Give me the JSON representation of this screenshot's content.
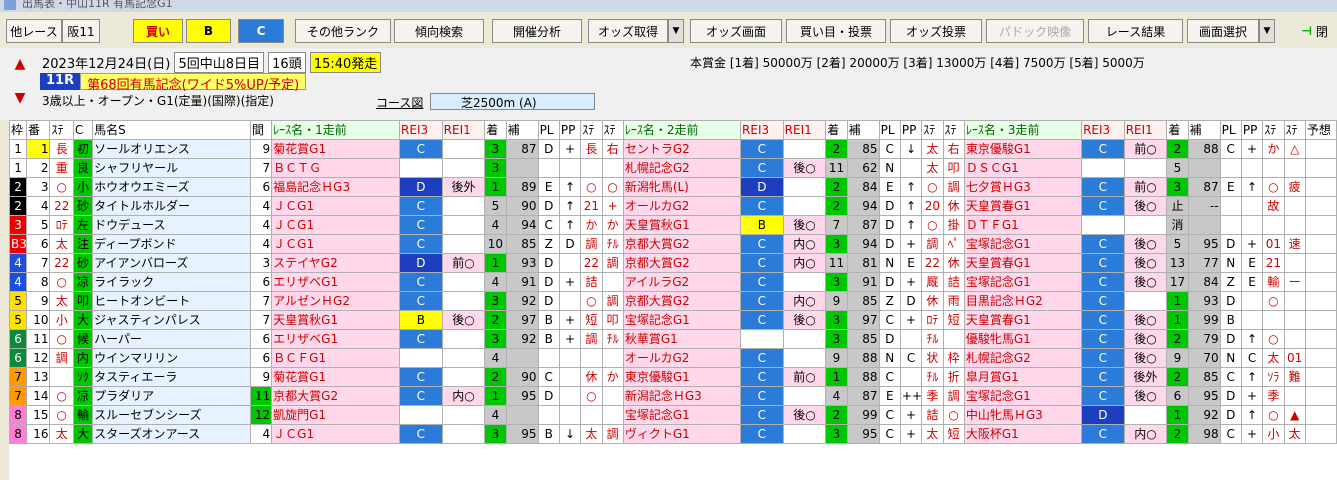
{
  "title": "出馬表・中山11R 有馬記念G1",
  "toolbar": {
    "other": "他レース",
    "race": "阪11",
    "buy": "買い",
    "b": "B",
    "c": "C",
    "other_rank": "その他ランク",
    "trend": "傾向検索",
    "analysis": "開催分析",
    "odds_get": "オッズ取得",
    "odds_view": "オッズ画面",
    "bet": "買い目・投票",
    "odds_vote": "オッズ投票",
    "video": "パドック映像",
    "result": "レース結果",
    "select": "画面選択",
    "close": "閉"
  },
  "info": {
    "date": "2023年12月24日(日)",
    "kai": "5回中山8日目",
    "heads": "16頭",
    "start": "15:40発走",
    "prize": "本賞金 [1着] 50000万 [2着] 20000万 [3着] 13000万 [4着] 7500万 [5着] 5000万",
    "race_no": "11R",
    "race_name": "第68回有馬記念(ワイド5%UP/予定)",
    "cond": "3歳以上・オープン・G1(定量)(国際)(指定)",
    "course_label": "コース図",
    "course": "芝2500m (A)"
  },
  "headers": [
    "枠",
    "番",
    "ｽﾃ",
    "C",
    "馬名S",
    "間",
    "ﾚｰｽ名・1走前",
    "REI3",
    "REI1",
    "着",
    "補",
    "PL",
    "PP",
    "ｽﾃ",
    "ｽﾃ",
    "ﾚｰｽ名・2走前",
    "REI3",
    "REI1",
    "着",
    "補",
    "PL",
    "PP",
    "ｽﾃ",
    "ｽﾃ",
    "ﾚｰｽ名・3走前",
    "REI3",
    "REI1",
    "着",
    "補",
    "PL",
    "PP",
    "ｽﾃ",
    "ｽﾃ",
    "予想"
  ],
  "rows": [
    {
      "w": "1",
      "n": "1",
      "m": "長",
      "c": "初",
      "name": "ソールオリエンス",
      "i": "9",
      "r1": [
        "菊花賞G1",
        "C",
        "",
        "3",
        "87",
        "D",
        "+",
        "長",
        "右"
      ],
      "r2": [
        "セントラG2",
        "C",
        "",
        "2",
        "85",
        "C",
        "↓",
        "太",
        "右"
      ],
      "r3": [
        "東京優駿G1",
        "C",
        "前○",
        "2",
        "88",
        "C",
        "+",
        "か",
        "△"
      ]
    },
    {
      "w": "1",
      "n": "2",
      "m": "重",
      "c": "良",
      "name": "シャフリヤール",
      "i": "7",
      "r1": [
        "ＢＣＴＧ",
        "",
        "",
        "3",
        "",
        "",
        "",
        "",
        ""
      ],
      "r2": [
        "札幌記念G2",
        "C",
        "後○",
        "11",
        "62",
        "N",
        "",
        "太",
        "叩"
      ],
      "r3": [
        "ＤＳＣG1",
        "",
        "",
        "5",
        "",
        "",
        "",
        "",
        ""
      ]
    },
    {
      "w": "2",
      "n": "3",
      "m": "○",
      "c": "小",
      "name": "ホウオウエミーズ",
      "i": "6",
      "r1": [
        "福島記念ＨG3",
        "D",
        "後外",
        "1",
        "89",
        "E",
        "↑",
        "○",
        "○"
      ],
      "r2": [
        "新潟牝馬(L)",
        "D",
        "",
        "2",
        "84",
        "E",
        "↑",
        "○",
        "調"
      ],
      "r3": [
        "七夕賞ＨG3",
        "C",
        "前○",
        "3",
        "87",
        "E",
        "↑",
        "○",
        "疲"
      ]
    },
    {
      "w": "2",
      "n": "4",
      "m": "22",
      "c": "砂",
      "name": "タイトルホルダー",
      "i": "4",
      "r1": [
        "ＪＣG1",
        "C",
        "",
        "5",
        "90",
        "D",
        "↑",
        "21",
        "+"
      ],
      "r2": [
        "オールカG2",
        "C",
        "",
        "2",
        "94",
        "D",
        "↑",
        "20",
        "休"
      ],
      "r3": [
        "天皇賞春G1",
        "C",
        "後○",
        "止",
        "--",
        "",
        "",
        "故",
        ""
      ]
    },
    {
      "w": "3",
      "n": "5",
      "m": "ﾛﾃ",
      "c": "左",
      "name": "ドウデュース",
      "i": "4",
      "r1": [
        "ＪＣG1",
        "C",
        "",
        "4",
        "94",
        "C",
        "↑",
        "か",
        "か"
      ],
      "r2": [
        "天皇賞秋G1",
        "B",
        "後○",
        "7",
        "87",
        "D",
        "↑",
        "○",
        "掛"
      ],
      "r3": [
        "ＤＴＦG1",
        "",
        "",
        "消",
        "",
        "",
        "",
        "",
        ""
      ]
    },
    {
      "w": "B3",
      "n": "6",
      "m": "太",
      "c": "注",
      "name": "ディープボンド",
      "i": "4",
      "r1": [
        "ＪＣG1",
        "C",
        "",
        "10",
        "85",
        "Z",
        "D",
        "調",
        "ﾁﾙ"
      ],
      "r2": [
        "京都大賞G2",
        "C",
        "内○",
        "3",
        "94",
        "D",
        "+",
        "調",
        "ﾍﾟ"
      ],
      "r3": [
        "宝塚記念G1",
        "C",
        "後○",
        "5",
        "95",
        "D",
        "+",
        "01",
        "速"
      ]
    },
    {
      "w": "4",
      "n": "7",
      "m": "22",
      "c": "砂",
      "name": "アイアンバローズ",
      "i": "3",
      "r1": [
        "ステイヤG2",
        "D",
        "前○",
        "1",
        "93",
        "D",
        "",
        "22",
        "調"
      ],
      "r2": [
        "京都大賞G2",
        "C",
        "内○",
        "11",
        "81",
        "N",
        "E",
        "22",
        "休"
      ],
      "r3": [
        "天皇賞春G1",
        "C",
        "後○",
        "13",
        "77",
        "N",
        "E",
        "21",
        ""
      ]
    },
    {
      "w": "4",
      "n": "8",
      "m": "○",
      "c": "凉",
      "name": "ライラック",
      "i": "6",
      "r1": [
        "エリザベG1",
        "C",
        "",
        "4",
        "91",
        "D",
        "+",
        "詰",
        ""
      ],
      "r2": [
        "アイルラG2",
        "C",
        "",
        "3",
        "91",
        "D",
        "+",
        "厩",
        "詰"
      ],
      "r3": [
        "宝塚記念G1",
        "C",
        "後○",
        "17",
        "84",
        "Z",
        "E",
        "輸",
        "ー"
      ]
    },
    {
      "w": "5",
      "n": "9",
      "m": "太",
      "c": "叩",
      "name": "ヒートオンビート",
      "i": "7",
      "r1": [
        "アルゼンＨG2",
        "C",
        "",
        "3",
        "92",
        "D",
        "",
        "○",
        "調"
      ],
      "r2": [
        "京都大賞G2",
        "C",
        "内○",
        "9",
        "85",
        "Z",
        "D",
        "休",
        "雨"
      ],
      "r3": [
        "目黒記念ＨG2",
        "C",
        "",
        "1",
        "93",
        "D",
        "",
        "○",
        ""
      ]
    },
    {
      "w": "5",
      "n": "10",
      "m": "小",
      "c": "大",
      "name": "ジャスティンパレス",
      "i": "7",
      "r1": [
        "天皇賞秋G1",
        "B",
        "後○",
        "2",
        "97",
        "B",
        "+",
        "短",
        "叩"
      ],
      "r2": [
        "宝塚記念G1",
        "C",
        "後○",
        "3",
        "97",
        "C",
        "+",
        "ﾛﾃ",
        "短"
      ],
      "r3": [
        "天皇賞春G1",
        "C",
        "後○",
        "1",
        "99",
        "B",
        "",
        "",
        ""
      ]
    },
    {
      "w": "6",
      "n": "11",
      "m": "○",
      "c": "候",
      "name": "ハーパー",
      "i": "6",
      "r1": [
        "エリザベG1",
        "C",
        "",
        "3",
        "92",
        "B",
        "+",
        "調",
        "ﾁﾙ"
      ],
      "r2": [
        "秋華賞G1",
        "",
        "",
        "3",
        "85",
        "D",
        "",
        "ﾁﾙ",
        ""
      ],
      "r3": [
        "優駿牝馬G1",
        "C",
        "後○",
        "2",
        "79",
        "D",
        "↑",
        "○",
        ""
      ]
    },
    {
      "w": "6",
      "n": "12",
      "m": "調",
      "c": "内",
      "name": "ウインマリリン",
      "i": "6",
      "r1": [
        "ＢＣＦG1",
        "",
        "",
        "4",
        "",
        "",
        "",
        "",
        ""
      ],
      "r2": [
        "オールカG2",
        "C",
        "",
        "9",
        "88",
        "N",
        "C",
        "状",
        "枠"
      ],
      "r3": [
        "札幌記念G2",
        "C",
        "後○",
        "9",
        "70",
        "N",
        "C",
        "太",
        "01"
      ]
    },
    {
      "w": "7",
      "n": "13",
      "m": "",
      "c": "ｿｸ",
      "name": "タスティエーラ",
      "i": "9",
      "r1": [
        "菊花賞G1",
        "C",
        "",
        "2",
        "90",
        "C",
        "",
        "休",
        "か"
      ],
      "r2": [
        "東京優駿G1",
        "C",
        "前○",
        "1",
        "88",
        "C",
        "",
        "ﾁﾙ",
        "折"
      ],
      "r3": [
        "皐月賞G1",
        "C",
        "後外",
        "2",
        "85",
        "C",
        "↑",
        "ｿﾗ",
        "難"
      ]
    },
    {
      "w": "7",
      "n": "14",
      "m": "○",
      "c": "凉",
      "name": "プラダリア",
      "i": "11",
      "r1": [
        "京都大賞G2",
        "C",
        "内○",
        "1",
        "95",
        "D",
        "",
        "○",
        ""
      ],
      "r2": [
        "新潟記念ＨG3",
        "C",
        "",
        "4",
        "87",
        "E",
        "++",
        "季",
        "調"
      ],
      "r3": [
        "宝塚記念G1",
        "C",
        "後○",
        "6",
        "95",
        "D",
        "+",
        "季",
        ""
      ]
    },
    {
      "w": "8",
      "n": "15",
      "m": "○",
      "c": "輸",
      "name": "スルーセブンシーズ",
      "i": "12",
      "r1": [
        "凱旋門G1",
        "",
        "",
        "4",
        "",
        "",
        "",
        "",
        ""
      ],
      "r2": [
        "宝塚記念G1",
        "C",
        "後○",
        "2",
        "99",
        "C",
        "+",
        "詰",
        "○"
      ],
      "r3": [
        "中山牝馬ＨG3",
        "D",
        "",
        "1",
        "92",
        "D",
        "↑",
        "○",
        "▲"
      ]
    },
    {
      "w": "8",
      "n": "16",
      "m": "太",
      "c": "大",
      "name": "スターズオンアース",
      "i": "4",
      "r1": [
        "ＪＣG1",
        "C",
        "",
        "3",
        "95",
        "B",
        "↓",
        "太",
        "調"
      ],
      "r2": [
        "ヴィクトG1",
        "C",
        "",
        "3",
        "95",
        "C",
        "+",
        "太",
        "短"
      ],
      "r3": [
        "大阪杯G1",
        "C",
        "内○",
        "2",
        "98",
        "C",
        "+",
        "小",
        "太"
      ]
    }
  ],
  "colors": {
    "waku1": "#ffffff",
    "waku2": "#000000",
    "waku3": "#ee0000",
    "waku4": "#1e4fd8",
    "waku5": "#ffe000",
    "waku6": "#0a8a3a",
    "waku7": "#ff9a00",
    "waku8": "#ff7fd4",
    "rank_c": "#2b7bd8",
    "rank_d": "#1d3fbf",
    "rank_b": "#ffff00"
  }
}
